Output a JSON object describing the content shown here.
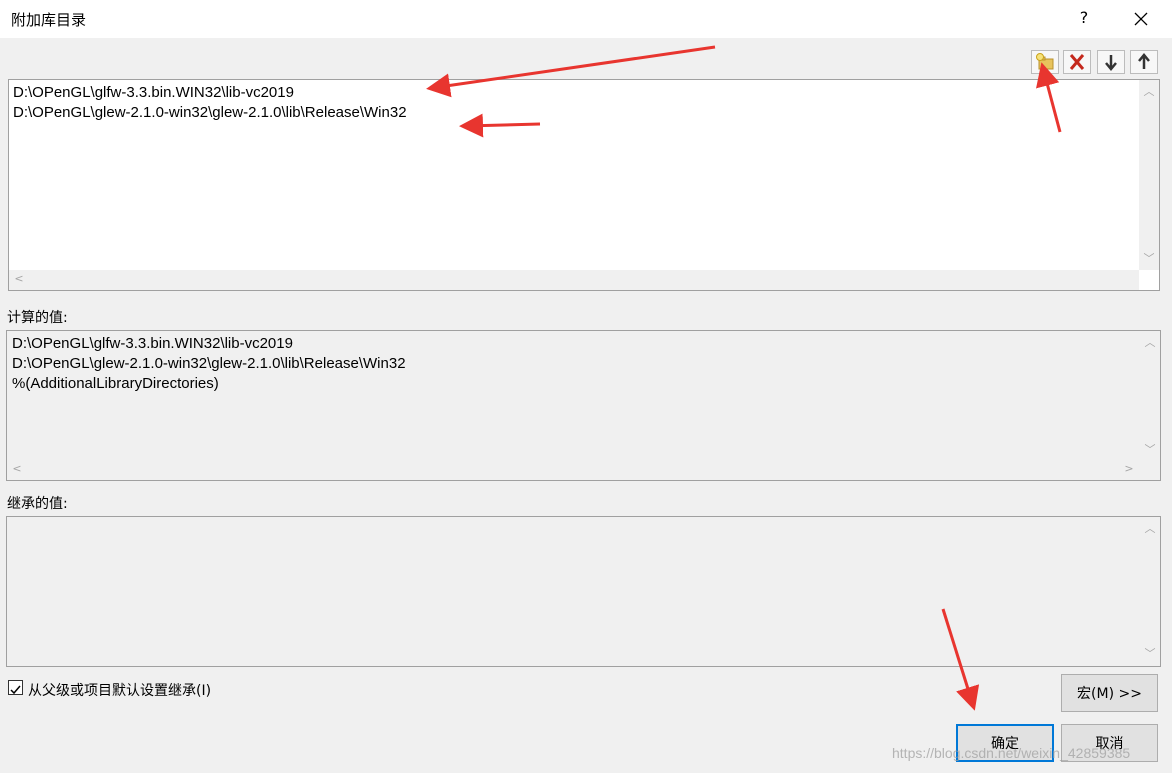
{
  "dialog": {
    "title": "附加库目录",
    "help_label": "?"
  },
  "toolbar": {
    "buttons": [
      {
        "name": "new-line-button",
        "icon": "new-folder-icon"
      },
      {
        "name": "delete-line-button",
        "icon": "delete-x-icon"
      },
      {
        "name": "move-down-button",
        "icon": "arrow-down-icon"
      },
      {
        "name": "move-up-button",
        "icon": "arrow-up-icon"
      }
    ]
  },
  "entries": [
    "D:\\OPenGL\\glfw-3.3.bin.WIN32\\lib-vc2019",
    "D:\\OPenGL\\glew-2.1.0-win32\\glew-2.1.0\\lib\\Release\\Win32"
  ],
  "evaluated": {
    "label": "计算的值:",
    "lines": [
      "D:\\OPenGL\\glfw-3.3.bin.WIN32\\lib-vc2019",
      "D:\\OPenGL\\glew-2.1.0-win32\\glew-2.1.0\\lib\\Release\\Win32",
      "%(AdditionalLibraryDirectories)"
    ]
  },
  "inherited": {
    "label": "继承的值:"
  },
  "inherit_checkbox": {
    "label": "从父级或项目默认设置继承(I)",
    "checked": true
  },
  "buttons": {
    "macro": "宏(M) >>",
    "ok": "确定",
    "cancel": "取消"
  },
  "watermark": "https://blog.csdn.net/weixin_42859385",
  "colors": {
    "annotation_arrow": "#e8352f",
    "focus_border": "#0078d7"
  }
}
